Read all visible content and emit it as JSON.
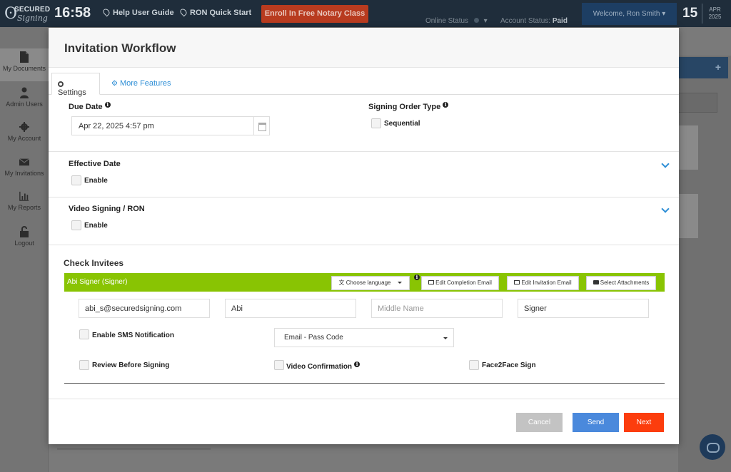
{
  "app": {
    "logo_line1": "SECURED",
    "logo_line2": "Signing",
    "time": "16:58",
    "help_link": "Help User Guide",
    "ron_link": "RON Quick Start",
    "enroll_button": "Enroll In Free Notary Class",
    "online_status_label": "Online Status",
    "account_status_label": "Account Status:",
    "account_status_value": "Paid",
    "welcome": "Welcome,  Ron Smith",
    "day": "15",
    "month": "APR",
    "year": "2025"
  },
  "sidebar": {
    "items": [
      {
        "label": "My Documents",
        "icon": "document-icon"
      },
      {
        "label": "Admin Users",
        "icon": "user-icon"
      },
      {
        "label": "My Account",
        "icon": "gear-icon"
      },
      {
        "label": "My Invitations",
        "icon": "envelope-icon"
      },
      {
        "label": "My Reports",
        "icon": "bar-chart-icon"
      },
      {
        "label": "Logout",
        "icon": "lock-icon"
      }
    ]
  },
  "modal": {
    "title": "Invitation Workflow",
    "tabs": [
      {
        "label": "Settings",
        "icon": "gear-icon",
        "active": true
      },
      {
        "label": "More Features",
        "icon": "gears-icon",
        "active": false
      }
    ],
    "due_date": {
      "label": "Due Date",
      "value": "Apr 22, 2025 4:57 pm"
    },
    "signing_order": {
      "label": "Signing Order Type",
      "option": "Sequential"
    },
    "effective_date": {
      "label": "Effective Date",
      "option": "Enable"
    },
    "video_signing": {
      "label": "Video Signing / RON",
      "option": "Enable"
    },
    "check_invitees": {
      "title": "Check Invitees",
      "signer": {
        "name": "Abi Signer (Signer)",
        "language_button": "Choose language",
        "completion_email_button": "Edit Completion Email",
        "invitation_email_button": "Edit Invitation Email",
        "attachments_button": "Select Attachments",
        "email": "abi_s@securedsigning.com",
        "first_name": "Abi",
        "middle_name_placeholder": "Middle Name",
        "last_name": "Signer",
        "sms_label": "Enable SMS Notification",
        "auth_method": "Email - Pass Code",
        "review_label": "Review Before Signing",
        "video_confirmation_label": "Video Confirmation",
        "face2face_label": "Face2Face Sign"
      }
    },
    "footer": {
      "cancel": "Cancel",
      "send": "Send",
      "next": "Next"
    }
  },
  "colors": {
    "topbar": "#1f2d3b",
    "signer_bar": "#89c403",
    "send_button": "#4a89dc",
    "next_button": "#fc3d0d",
    "cancel_button": "#c3c3c3",
    "link": "#2d8ed6"
  }
}
